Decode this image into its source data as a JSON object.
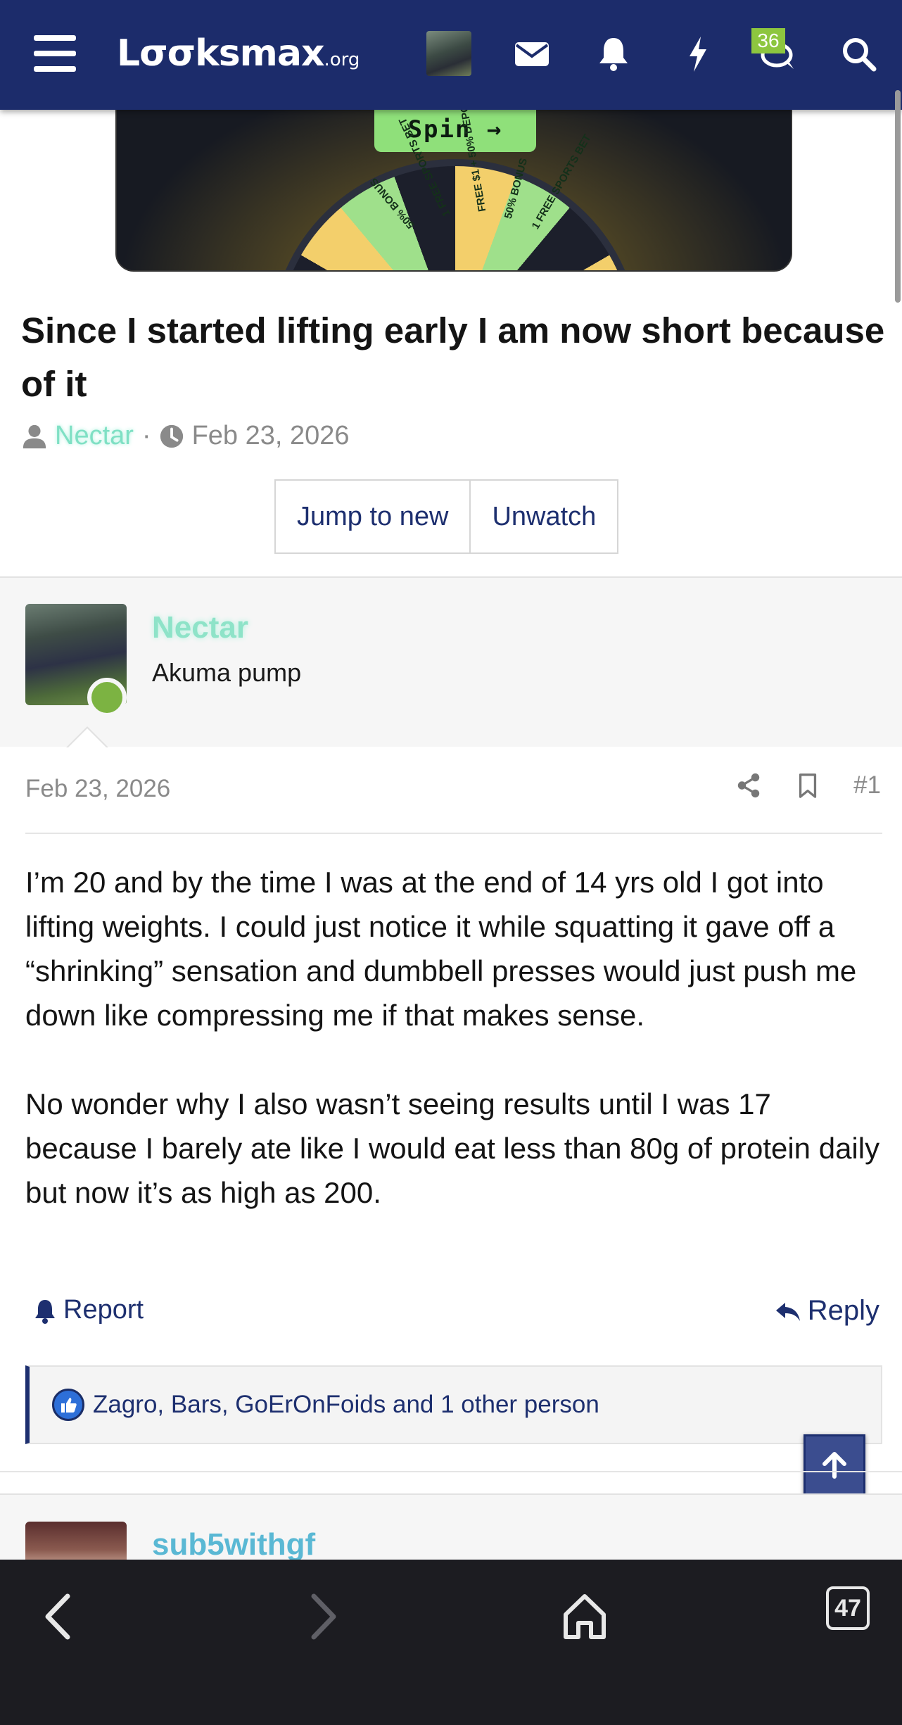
{
  "header": {
    "logo_main": "Lxxksmax",
    "logo_display": "Lσσksmax",
    "logo_suffix": ".org",
    "notification_badge": "36",
    "colors": {
      "bar": "#1c2c6b",
      "badge": "#8dc63f"
    },
    "icons": [
      "menu-icon",
      "user-avatar",
      "mail-icon",
      "bell-icon",
      "bolt-icon",
      "chat-icon",
      "search-icon"
    ]
  },
  "ad": {
    "button_label": "Spin →",
    "wheel_segments": [
      "FREE $1 + 50% DEPOSIT",
      "50% BONUS",
      "1 FREE SPORTS BET",
      "FREE $1 + 50% DEPOSIT",
      "50% BONUS",
      "1 FREE SPORTS BET",
      "FREE $1 + 50% DEPOSIT"
    ]
  },
  "thread": {
    "title": "Since I started lifting early I am now short because of it",
    "author": "Nectar",
    "separator": "·",
    "date": "Feb 23, 2026",
    "buttons": {
      "jump_to_new": "Jump to new",
      "unwatch": "Unwatch"
    }
  },
  "post": {
    "username": "Nectar",
    "user_title": "Akuma pump",
    "date": "Feb 23, 2026",
    "number": "#1",
    "paragraphs": [
      "I’m 20 and by the time I was at the end of 14 yrs old I got into lifting weights. I could just notice it while squatting it gave off a “shrinking” sensation and dumbbell presses would just push me down like compressing me if that makes sense.",
      "No wonder why I also wasn’t seeing results until I was 17 because I barely ate like I would eat less than 80g of protein daily but now it’s as high as 200."
    ],
    "report_label": "Report",
    "reply_label": "Reply",
    "reactions_text": "Zagro, Bars, GoErOnFoids and 1 other person"
  },
  "next_post": {
    "username": "sub5withgf"
  },
  "browser": {
    "tab_count": "47"
  }
}
